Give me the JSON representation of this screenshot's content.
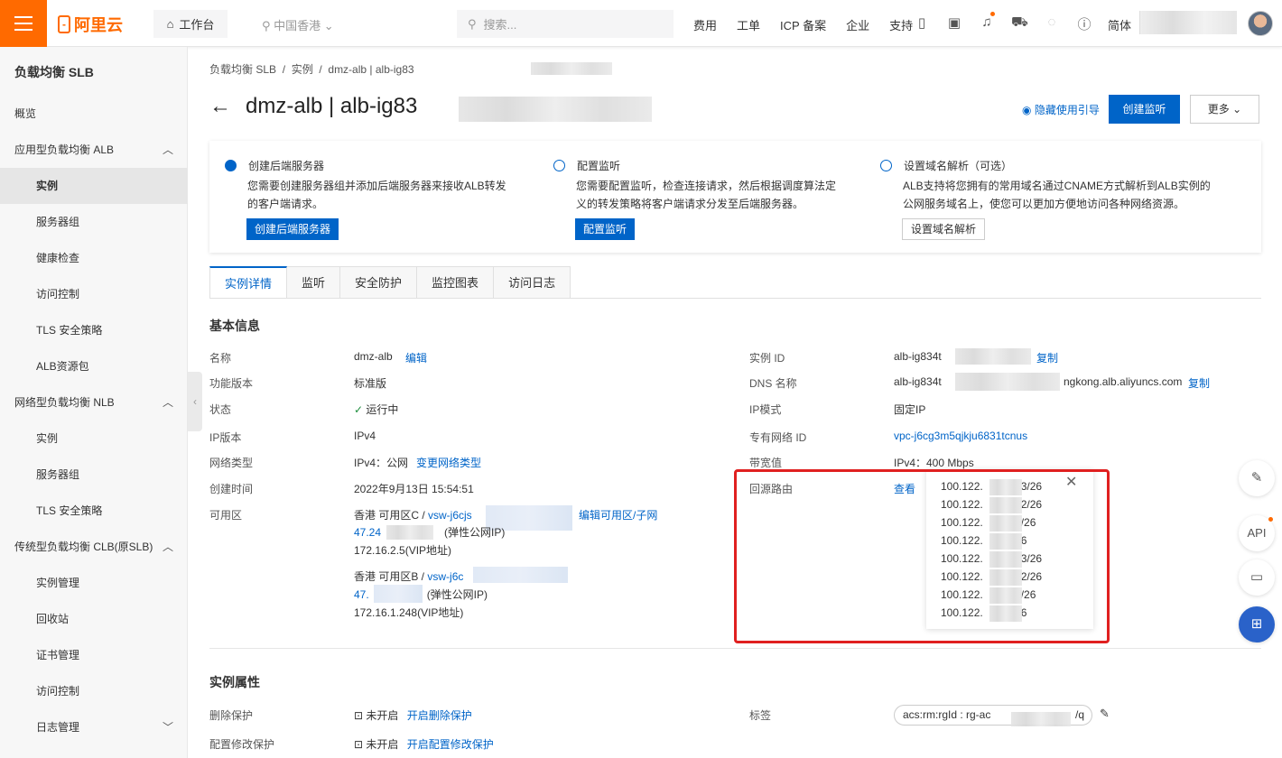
{
  "topbar": {
    "logo": "阿里云",
    "workbench": "工作台",
    "region": "中国香港",
    "search_placeholder": "搜索...",
    "links": [
      "费用",
      "工单",
      "ICP 备案",
      "企业",
      "支持"
    ],
    "lang": "简体"
  },
  "sidebar": {
    "title": "负载均衡 SLB",
    "items": [
      {
        "label": "概览",
        "sub": false
      },
      {
        "label": "应用型负载均衡 ALB",
        "sub": false,
        "chev": "up"
      },
      {
        "label": "实例",
        "sub": true,
        "active": true
      },
      {
        "label": "服务器组",
        "sub": true
      },
      {
        "label": "健康检查",
        "sub": true
      },
      {
        "label": "访问控制",
        "sub": true
      },
      {
        "label": "TLS 安全策略",
        "sub": true
      },
      {
        "label": "ALB资源包",
        "sub": true
      },
      {
        "label": "网络型负载均衡 NLB",
        "sub": false,
        "chev": "up"
      },
      {
        "label": "实例",
        "sub": true
      },
      {
        "label": "服务器组",
        "sub": true
      },
      {
        "label": "TLS 安全策略",
        "sub": true
      },
      {
        "label": "传统型负载均衡 CLB(原SLB)",
        "sub": false,
        "chev": "up"
      },
      {
        "label": "实例管理",
        "sub": true
      },
      {
        "label": "回收站",
        "sub": true
      },
      {
        "label": "证书管理",
        "sub": true
      },
      {
        "label": "访问控制",
        "sub": true
      },
      {
        "label": "日志管理",
        "sub": true,
        "chev": "down"
      }
    ]
  },
  "breadcrumb": [
    "负载均衡 SLB",
    "实例",
    "dmz-alb | alb-ig83"
  ],
  "page": {
    "title": "dmz-alb | alb-ig83",
    "hide_guide": "隐藏使用引导",
    "create_listener": "创建监听",
    "more": "更多"
  },
  "guide": [
    {
      "title": "创建后端服务器",
      "desc1": "您需要创建服务器组并添加后端服务器来接收ALB转发",
      "desc2": "的客户端请求。",
      "button": "创建后端服务器"
    },
    {
      "title": "配置监听",
      "desc1": "您需要配置监听，检查连接请求，然后根据调度算法定",
      "desc2": "义的转发策略将客户端请求分发至后端服务器。",
      "button": "配置监听"
    },
    {
      "title": "设置域名解析（可选）",
      "desc1": "ALB支持将您拥有的常用域名通过CNAME方式解析到ALB实例的",
      "desc2": "公网服务域名上，使您可以更加方便地访问各种网络资源。",
      "button": "设置域名解析"
    }
  ],
  "tabs": [
    "实例详情",
    "监听",
    "安全防护",
    "监控图表",
    "访问日志"
  ],
  "basic": {
    "heading": "基本信息",
    "name_label": "名称",
    "name": "dmz-alb",
    "edit": "编辑",
    "edition_label": "功能版本",
    "edition": "标准版",
    "status_label": "状态",
    "status": "运行中",
    "ipver_label": "IP版本",
    "ipver": "IPv4",
    "nettype_label": "网络类型",
    "nettype": "IPv4：公网",
    "change_nettype": "变更网络类型",
    "created_label": "创建时间",
    "created": "2022年9月13日 15:54:51",
    "zone_label": "可用区",
    "zone1": "香港 可用区C /",
    "zone1_vsw": "vsw-j6cjs",
    "edit_zone": "编辑可用区/子网",
    "zone1_eip": "47.24",
    "zone1_eip_suffix": "(弹性公网IP)",
    "zone1_vip": "172.16.2.5(VIP地址)",
    "zone2": "香港 可用区B /",
    "zone2_vsw": "vsw-j6c",
    "zone2_eip": "47.",
    "zone2_eip_suffix": "(弹性公网IP)",
    "zone2_vip": "172.16.1.248(VIP地址)",
    "id_label": "实例 ID",
    "id": "alb-ig834t",
    "copy": "复制",
    "dns_label": "DNS 名称",
    "dns_prefix": "alb-ig834t",
    "dns_suffix": "ngkong.alb.aliyuncs.com",
    "ipmode_label": "IP模式",
    "ipmode": "固定IP",
    "vpc_label": "专有网络 ID",
    "vpc": "vpc-j6cg3m5qjkju6831tcnus",
    "bw_label": "带宽值",
    "bw": "IPv4：400 Mbps",
    "route_label": "回源路由",
    "view": "查看",
    "routes": [
      "100.122.",
      "100.122.",
      "100.122.",
      "100.122.",
      "100.122.",
      "100.122.",
      "100.122.",
      "100.122."
    ],
    "route_suffixes": [
      "3/26",
      "2/26",
      "/26",
      "6",
      "3/26",
      "2/26",
      "/26",
      "6"
    ]
  },
  "attrs": {
    "heading": "实例属性",
    "del_label": "删除保护",
    "del_status": "未开启",
    "del_link": "开启删除保护",
    "mod_label": "配置修改保护",
    "mod_status": "未开启",
    "mod_link": "开启配置修改保护",
    "tag_label": "标签",
    "tag": "acs:rm:rgId : rg-ac",
    "tag_suffix": "/q"
  },
  "float": {
    "api": "API"
  },
  "colors": {
    "accent": "#0064c8",
    "brand": "#ff6a00",
    "highlight": "#e02020"
  }
}
